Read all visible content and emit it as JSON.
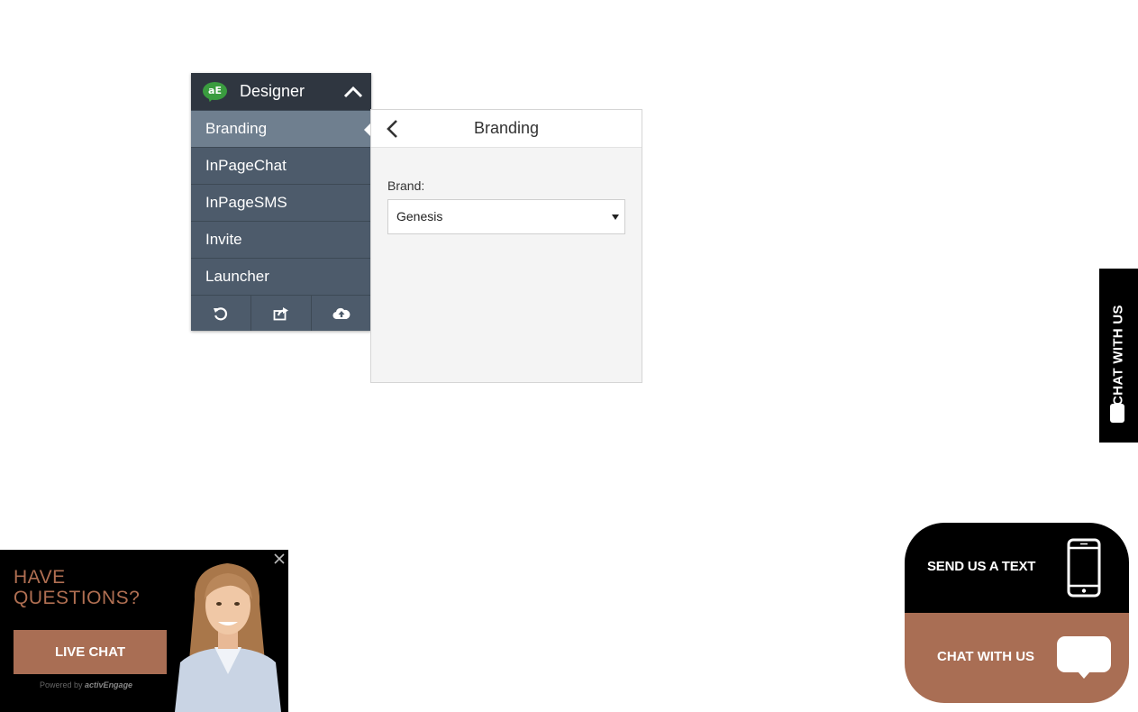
{
  "designer": {
    "logo_text": "aE",
    "title": "Designer",
    "menu": [
      {
        "label": "Branding"
      },
      {
        "label": "InPageChat"
      },
      {
        "label": "InPageSMS"
      },
      {
        "label": "Invite"
      },
      {
        "label": "Launcher"
      }
    ],
    "toolbar": [
      "undo-icon",
      "share-icon",
      "cloud-upload-icon"
    ]
  },
  "branding_panel": {
    "title": "Branding",
    "brand_label": "Brand:",
    "brand_value": "Genesis"
  },
  "side_tab": {
    "label": "CHAT WITH US"
  },
  "ad_banner": {
    "heading_line1": "HAVE",
    "heading_line2": "QUESTIONS?",
    "button_label": "LIVE CHAT",
    "powered_by": "Powered by",
    "brand_name": "activEngage"
  },
  "launcher": {
    "send_text_label": "SEND US A TEXT",
    "chat_label": "CHAT WITH US"
  },
  "colors": {
    "accent_brown": "#a96e54",
    "heading_brown": "#b06f52",
    "designer_dark": "#2f3640",
    "menu_bg": "#4d5b6b",
    "menu_active": "#6f7f8f",
    "logo_green": "#3a9c3f"
  }
}
